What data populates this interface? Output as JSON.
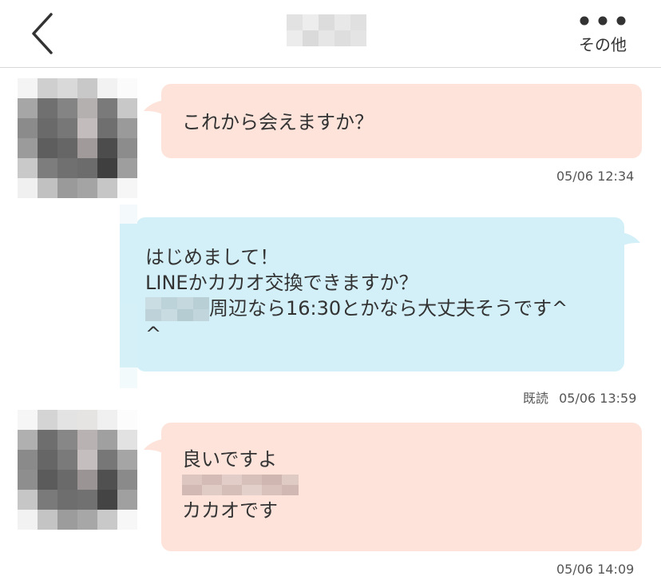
{
  "header": {
    "more_label": "その他"
  },
  "messages": [
    {
      "direction": "incoming",
      "text": "これから会えますか？",
      "time": "05/06 12:34"
    },
    {
      "direction": "outgoing",
      "line1": "はじめまして！",
      "line2": "LINEかカカオ交換できますか？",
      "line3_suffix": "周辺なら16:30とかなら大丈夫そうです^",
      "line4": "^",
      "read_label": "既読",
      "time": "05/06 13:59"
    },
    {
      "direction": "incoming",
      "line1": "良いですよ",
      "line3": "カカオです",
      "time": "05/06 14:09"
    }
  ],
  "colors": {
    "incoming_bubble": "#fde3da",
    "outgoing_bubble": "#d3eff8",
    "header_border": "#d8d8d8"
  }
}
